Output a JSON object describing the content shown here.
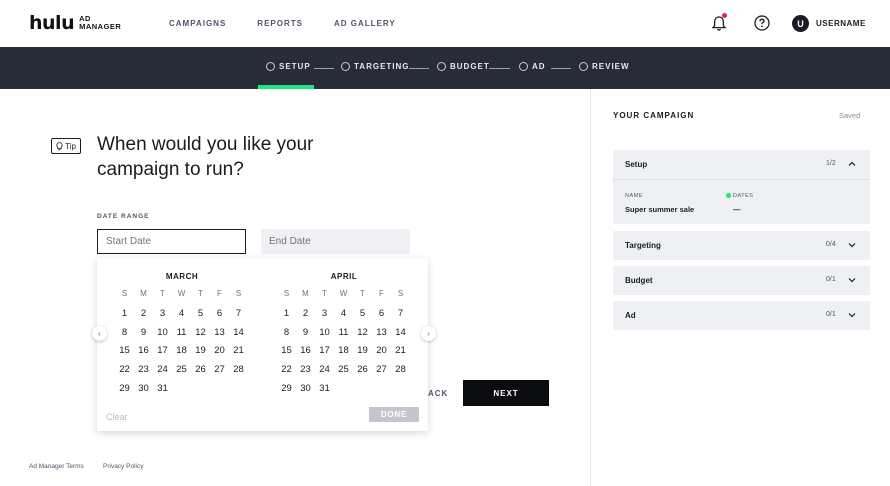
{
  "brand": {
    "name": "hulu",
    "sub_line1": "AD",
    "sub_line2": "MANAGER"
  },
  "nav": {
    "links": [
      "CAMPAIGNS",
      "REPORTS",
      "AD GALLERY"
    ],
    "avatar_initial": "U",
    "username": "USERNAME",
    "notification_color": "#e91e63"
  },
  "steps": [
    "SETUP",
    "TARGETING",
    "BUDGET",
    "AD",
    "REVIEW"
  ],
  "active_step": "SETUP",
  "accent_color": "#1ce783",
  "main": {
    "tip_label": "Tip",
    "question": "When would you like your campaign to run?",
    "date_range_label": "DATE RANGE",
    "start_placeholder": "Start Date",
    "end_placeholder": "End Date",
    "back_label": "ACK",
    "next_label": "NEXT"
  },
  "calendar": {
    "weekdays": [
      "S",
      "M",
      "T",
      "W",
      "T",
      "F",
      "S"
    ],
    "months": [
      {
        "name": "MARCH",
        "days": [
          "1",
          "2",
          "3",
          "4",
          "5",
          "6",
          "7",
          "8",
          "9",
          "10",
          "11",
          "12",
          "13",
          "14",
          "15",
          "16",
          "17",
          "18",
          "19",
          "20",
          "21",
          "22",
          "23",
          "24",
          "25",
          "26",
          "27",
          "28",
          "29",
          "30",
          "31"
        ]
      },
      {
        "name": "APRIL",
        "days": [
          "1",
          "2",
          "3",
          "4",
          "5",
          "6",
          "7",
          "8",
          "9",
          "10",
          "11",
          "12",
          "13",
          "14",
          "15",
          "16",
          "17",
          "18",
          "19",
          "20",
          "21",
          "22",
          "23",
          "24",
          "25",
          "26",
          "27",
          "28",
          "29",
          "30",
          "31"
        ]
      }
    ],
    "clear_label": "Clear",
    "done_label": "DONE"
  },
  "footer": {
    "terms": "Ad Manager Terms",
    "privacy": "Privacy Policy"
  },
  "campaign_panel": {
    "title": "YOUR CAMPAIGN",
    "status": "Saved",
    "sections": [
      {
        "name": "Setup",
        "progress": "1/2",
        "expanded": true
      },
      {
        "name": "Targeting",
        "progress": "0/4",
        "expanded": false
      },
      {
        "name": "Budget",
        "progress": "0/1",
        "expanded": false
      },
      {
        "name": "Ad",
        "progress": "0/1",
        "expanded": false
      }
    ],
    "setup_details": {
      "name_label": "NAME",
      "name_value": "Super summer sale",
      "dates_label": "DATES",
      "dates_value": "—"
    }
  }
}
